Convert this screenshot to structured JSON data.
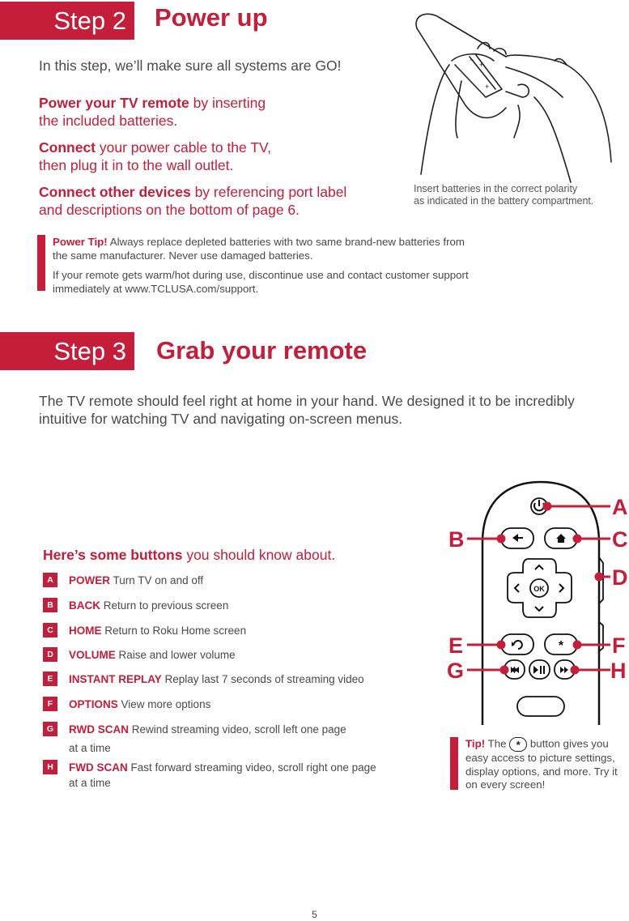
{
  "step2": {
    "label": "Step 2",
    "title": "Power up",
    "intro": "In this step, we’ll make sure all systems are GO!",
    "items": [
      {
        "bold": "Power your TV remote",
        "rest": " by inserting",
        "line2": "the included batteries."
      },
      {
        "bold": "Connect",
        "rest": " your power cable to the TV,",
        "line2": "then plug it in to the wall outlet."
      },
      {
        "bold": "Connect other devices",
        "rest": " by referencing port label",
        "line2": "and descriptions on the bottom of page 6."
      }
    ],
    "image_caption_1": "Insert batteries in the correct polarity",
    "image_caption_2": "as indicated in the battery compartment.",
    "tip": {
      "label": "Power Tip!",
      "text1": " Always replace depleted batteries with two same brand-new batteries from the same manufacturer. Never use damaged batteries.",
      "text2": "If your remote gets warm/hot during use, discontinue use and contact customer support immediately at www.TCLUSA.com/support."
    }
  },
  "step3": {
    "label": "Step 3",
    "title": "Grab your remote",
    "intro": "The TV remote should feel right at home in your hand. We designed it to be incredibly intuitive for watching TV and navigating on-screen menus.",
    "buttons_heading_bold": "Here’s some buttons",
    "buttons_heading_rest": " you should know about.",
    "buttons": [
      {
        "letter": "A",
        "name": "POWER",
        "desc": " Turn TV on and off"
      },
      {
        "letter": "B",
        "name": "BACK",
        "desc": " Return to previous screen"
      },
      {
        "letter": "C",
        "name": "HOME",
        "desc": " Return to Roku Home screen"
      },
      {
        "letter": "D",
        "name": "VOLUME",
        "desc": " Raise and lower volume"
      },
      {
        "letter": "E",
        "name": "INSTANT REPLAY",
        "desc": " Replay last 7 seconds of streaming video"
      },
      {
        "letter": "F",
        "name": "OPTIONS",
        "desc": " View more options"
      },
      {
        "letter": "G",
        "name": "RWD SCAN",
        "desc": " Rewind streaming video, scroll left one page",
        "desc2": "at a time"
      },
      {
        "letter": "H",
        "name": "FWD SCAN",
        "desc": " Fast forward streaming video, scroll right one page",
        "desc2": "at a time"
      }
    ],
    "remote_labels": {
      "A": "A",
      "B": "B",
      "C": "C",
      "D": "D",
      "E": "E",
      "F": "F",
      "G": "G",
      "H": "H"
    },
    "remote_button_text": {
      "ok": "OK"
    },
    "tip": {
      "label": "Tip!",
      "pre": " The ",
      "post": " button gives you easy access to picture settings, display options, and more. Try it on every screen!"
    }
  },
  "page_number": "5",
  "colors": {
    "accent": "#c41e3a",
    "text": "#4a4a4a"
  }
}
